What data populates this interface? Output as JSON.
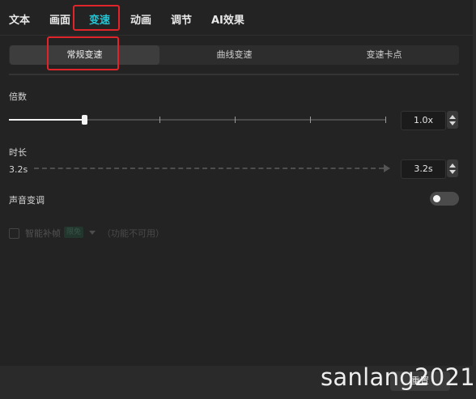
{
  "tabs": [
    {
      "label": "文本",
      "active": false
    },
    {
      "label": "画面",
      "active": false
    },
    {
      "label": "变速",
      "active": true
    },
    {
      "label": "动画",
      "active": false
    },
    {
      "label": "调节",
      "active": false
    },
    {
      "label": "AI效果",
      "active": false
    }
  ],
  "segment": {
    "items": [
      {
        "label": "常规变速",
        "active": true
      },
      {
        "label": "曲线变速",
        "active": false
      },
      {
        "label": "变速卡点",
        "active": false
      }
    ]
  },
  "speed": {
    "label": "倍数",
    "value": "1.0x",
    "slider_fraction": 0.2
  },
  "duration": {
    "label": "时长",
    "original": "3.2s",
    "value": "3.2s"
  },
  "pitch": {
    "label": "声音变调",
    "enabled": false
  },
  "smooth": {
    "label": "智能补帧",
    "badge": "限免",
    "hint": "（功能不可用）"
  },
  "footer": {
    "reset_label": "重置"
  },
  "watermark": "sanlang2021",
  "colors": {
    "accent": "#22c6d6",
    "highlight_box": "#e0242a",
    "background": "#232323"
  }
}
